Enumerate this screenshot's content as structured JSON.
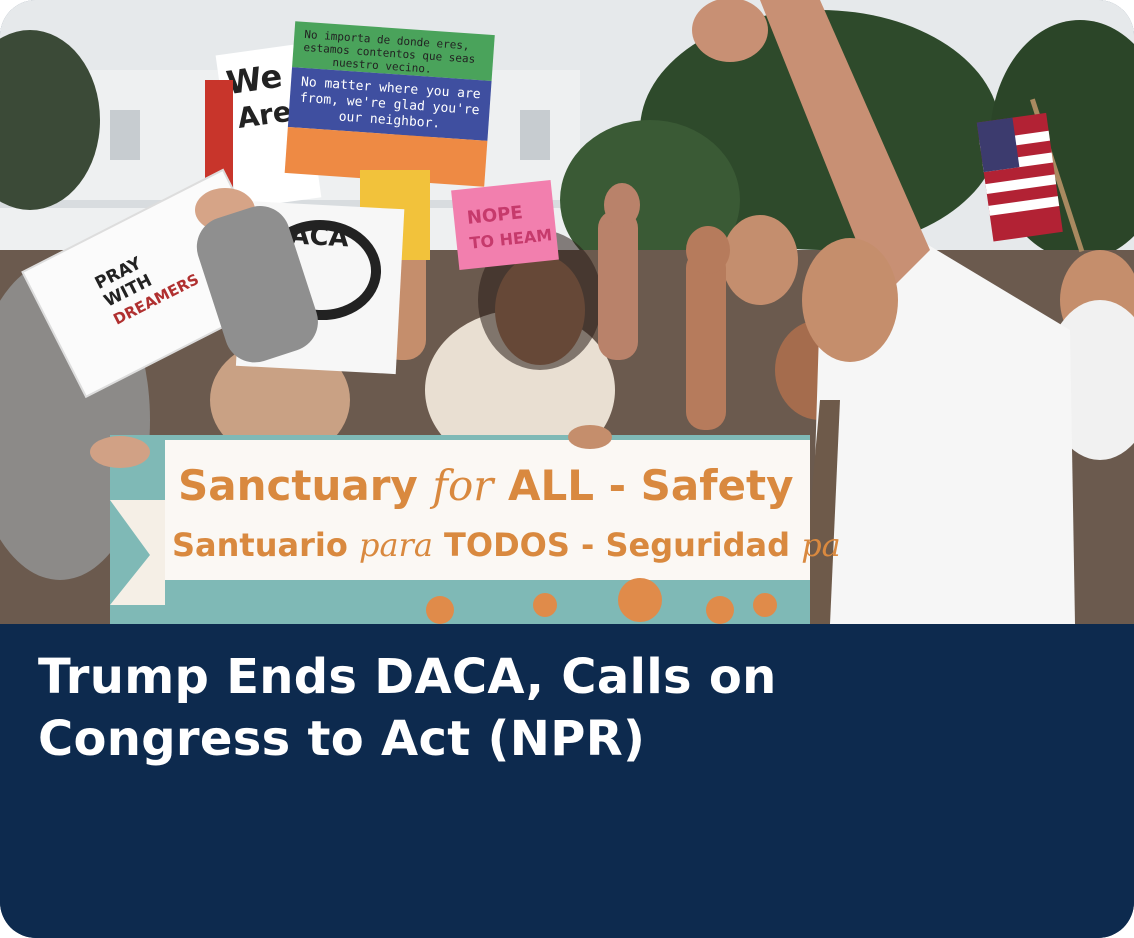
{
  "card": {
    "headline": "Trump Ends DACA, Calls on Congress to Act (NPR)"
  },
  "photo": {
    "banner_line_1_a": "Sanctuary ",
    "banner_line_1_b": "for",
    "banner_line_1_c": " ALL - Safety ",
    "banner_line_2_a": "Santuario ",
    "banner_line_2_b": "para",
    "banner_line_2_c": " TODOS - Seguridad ",
    "banner_line_2_d": "pa",
    "sign_pray_1": "PRAY",
    "sign_pray_2": "WITH",
    "sign_pray_3": "DREAMERS",
    "sign_we_1": "We",
    "sign_we_2": "Are",
    "sign_neighbor_es_1": "No importa de donde eres,",
    "sign_neighbor_es_2": "estamos contentos que seas",
    "sign_neighbor_es_3": "nuestro vecino.",
    "sign_neighbor_en_1": "No matter where you are",
    "sign_neighbor_en_2": "from, we're glad you're",
    "sign_neighbor_en_3": "our neighbor.",
    "sign_pink_1": "NOPE",
    "sign_pink_2": "TO HEAM",
    "sign_daca": "DACA"
  },
  "colors": {
    "caption_bg": "#0d2a4e",
    "headline": "#ffffff",
    "banner_text": "#d9893f",
    "banner_teal": "#7fb9b6"
  }
}
